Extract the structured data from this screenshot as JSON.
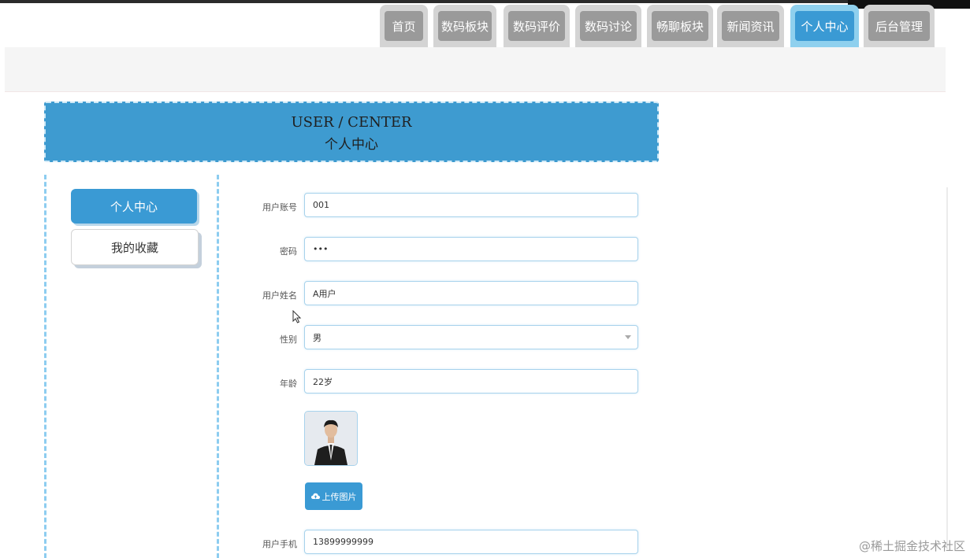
{
  "nav": {
    "tabs": [
      "首页",
      "数码板块",
      "数码评价",
      "数码讨论",
      "畅聊板块",
      "新闻资讯",
      "个人中心",
      "后台管理"
    ],
    "active_tab": "个人中心"
  },
  "banner": {
    "title_en": "USER / CENTER",
    "title_cn": "个人中心"
  },
  "sidebar": {
    "items": [
      "个人中心",
      "我的收藏"
    ],
    "active": "个人中心"
  },
  "form": {
    "account": {
      "label": "用户账号",
      "value": "001"
    },
    "password": {
      "label": "密码",
      "value": "•••"
    },
    "name": {
      "label": "用户姓名",
      "value": "A用户"
    },
    "gender": {
      "label": "性别",
      "value": "男"
    },
    "age": {
      "label": "年龄",
      "value": "22岁"
    },
    "upload_label": "上传图片",
    "phone": {
      "label": "用户手机",
      "value": "13899999999"
    }
  },
  "watermark": "@稀土掘金技术社区",
  "colors": {
    "accent": "#3a9ad4",
    "tab_inactive": "#9a9a9a",
    "border": "#a7d2ec"
  }
}
